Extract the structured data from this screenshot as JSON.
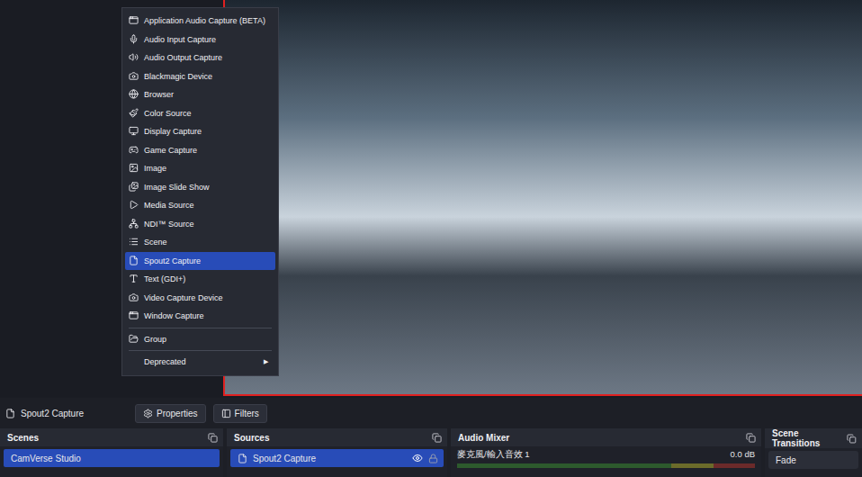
{
  "add_source_menu": {
    "sections": [
      [
        {
          "label": "Application Audio Capture (BETA)",
          "selected": false,
          "kind": "item"
        },
        {
          "label": "Audio Input Capture",
          "selected": false,
          "kind": "item"
        },
        {
          "label": "Audio Output Capture",
          "selected": false,
          "kind": "item"
        },
        {
          "label": "Blackmagic Device",
          "selected": false,
          "kind": "item"
        },
        {
          "label": "Browser",
          "selected": false,
          "kind": "item"
        },
        {
          "label": "Color Source",
          "selected": false,
          "kind": "item"
        },
        {
          "label": "Display Capture",
          "selected": false,
          "kind": "item"
        },
        {
          "label": "Game Capture",
          "selected": false,
          "kind": "item"
        },
        {
          "label": "Image",
          "selected": false,
          "kind": "item"
        },
        {
          "label": "Image Slide Show",
          "selected": false,
          "kind": "item"
        },
        {
          "label": "Media Source",
          "selected": false,
          "kind": "item"
        },
        {
          "label": "NDI™ Source",
          "selected": false,
          "kind": "item"
        },
        {
          "label": "Scene",
          "selected": false,
          "kind": "item"
        },
        {
          "label": "Spout2 Capture",
          "selected": true,
          "kind": "item"
        },
        {
          "label": "Text (GDI+)",
          "selected": false,
          "kind": "item"
        },
        {
          "label": "Video Capture Device",
          "selected": false,
          "kind": "item"
        },
        {
          "label": "Window Capture",
          "selected": false,
          "kind": "item"
        }
      ],
      [
        {
          "label": "Group",
          "selected": false,
          "kind": "item"
        }
      ],
      [
        {
          "label": "Deprecated",
          "selected": false,
          "kind": "submenu",
          "arrow": "▶"
        }
      ]
    ]
  },
  "preview": {
    "source_selected": true
  },
  "source_toolbar": {
    "source_name": "Spout2 Capture",
    "buttons": [
      "Properties",
      "Filters"
    ]
  },
  "scenes": {
    "title": "Scenes",
    "items": [
      {
        "label": "CamVerse Studio",
        "selected": true
      }
    ]
  },
  "sources": {
    "title": "Sources",
    "items": [
      {
        "label": "Spout2 Capture",
        "selected": true,
        "visible": true,
        "locked": false
      }
    ]
  },
  "audio_mixer": {
    "title": "Audio Mixer",
    "channels": [
      {
        "name": "麥克風/輸入音效 1",
        "reading": "0.0 dB",
        "level": 0
      }
    ]
  },
  "scene_transitions": {
    "title": "Scene Transitions",
    "value": "Fade"
  }
}
